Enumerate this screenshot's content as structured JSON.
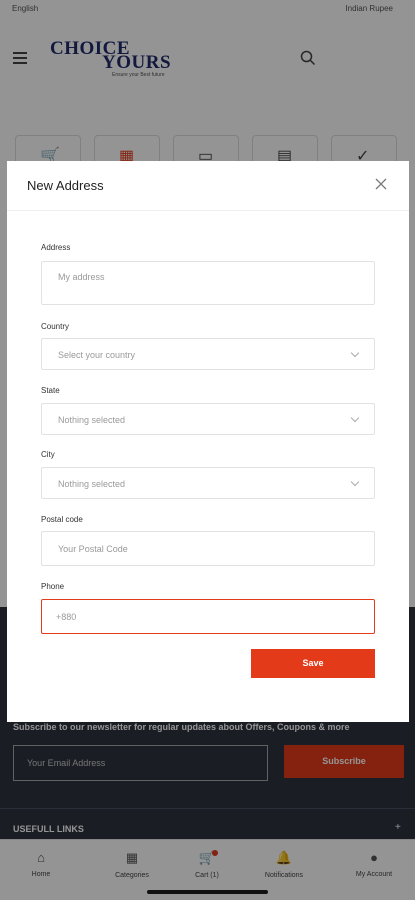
{
  "topbar": {
    "language": "English",
    "currency": "Indian Rupee"
  },
  "logo": {
    "line1": "CHOICE",
    "line2": "YOURS",
    "tagline": "Ensure your Best future"
  },
  "newsletter": {
    "text": "Subscribe to our newsletter for regular updates about Offers, Coupons & more",
    "email_placeholder": "Your Email Address",
    "subscribe_label": "Subscribe"
  },
  "links": {
    "title": "USEFULL LINKS",
    "toggle": "+"
  },
  "bottom_nav": [
    {
      "label": "Home",
      "icon": "home-icon"
    },
    {
      "label": "Categories",
      "icon": "grid-icon"
    },
    {
      "label": "Cart (1)",
      "icon": "cart-icon"
    },
    {
      "label": "Notifications",
      "icon": "bell-icon"
    },
    {
      "label": "My Account",
      "icon": "user-icon"
    }
  ],
  "modal": {
    "title": "New Address",
    "address": {
      "label": "Address",
      "placeholder": "My address"
    },
    "country": {
      "label": "Country",
      "value": "Select your country"
    },
    "state": {
      "label": "State",
      "value": "Nothing selected"
    },
    "city": {
      "label": "City",
      "value": "Nothing selected"
    },
    "postal": {
      "label": "Postal code",
      "placeholder": "Your Postal Code"
    },
    "phone": {
      "label": "Phone",
      "value": "+880"
    },
    "save_label": "Save"
  },
  "colors": {
    "accent": "#e33b1a",
    "dark_footer": "#2d333f",
    "brand_navy": "#1f2a6b"
  }
}
